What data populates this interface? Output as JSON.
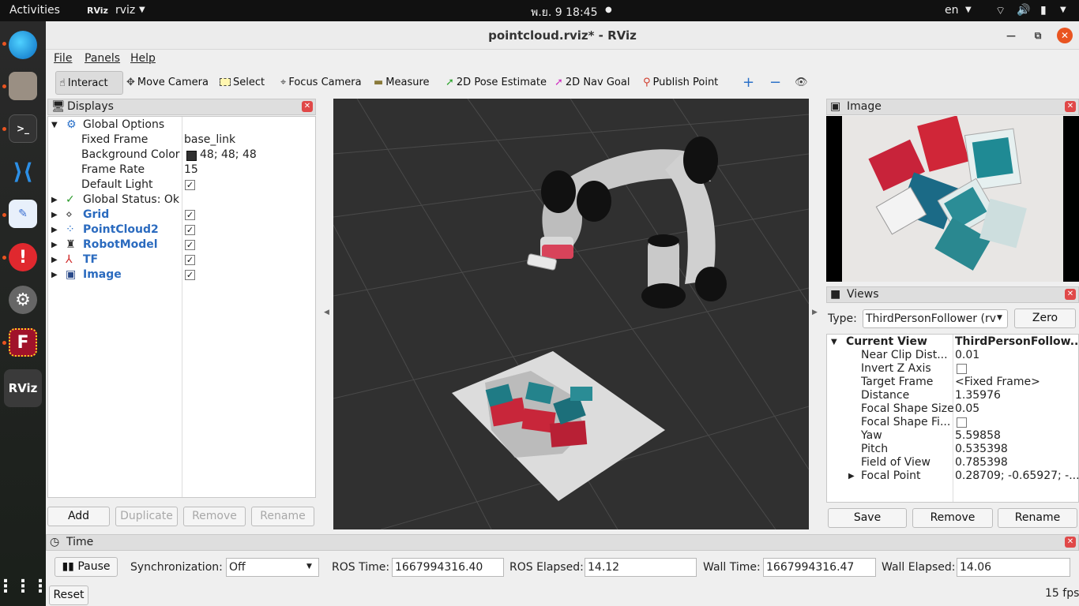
{
  "topbar": {
    "activities": "Activities",
    "app": "rviz",
    "clock": "พ.ย. 9  18:45",
    "lang": "en"
  },
  "window": {
    "title": "pointcloud.rviz* - RViz"
  },
  "menu": {
    "file": "File",
    "panels": "Panels",
    "help": "Help"
  },
  "toolbar": {
    "interact": "Interact",
    "move_camera": "Move Camera",
    "select": "Select",
    "focus_camera": "Focus Camera",
    "measure": "Measure",
    "pose_estimate": "2D Pose Estimate",
    "nav_goal": "2D Nav Goal",
    "publish_point": "Publish Point"
  },
  "displays": {
    "title": "Displays",
    "global_options": "Global Options",
    "fixed_frame_label": "Fixed Frame",
    "fixed_frame_value": "base_link",
    "bg_color_label": "Background Color",
    "bg_color_value": "48; 48; 48",
    "frame_rate_label": "Frame Rate",
    "frame_rate_value": "15",
    "default_light_label": "Default Light",
    "global_status": "Global Status: Ok",
    "grid": "Grid",
    "pointcloud2": "PointCloud2",
    "robotmodel": "RobotModel",
    "tf": "TF",
    "image": "Image",
    "add": "Add",
    "duplicate": "Duplicate",
    "remove": "Remove",
    "rename": "Rename"
  },
  "image_panel": {
    "title": "Image"
  },
  "views": {
    "title": "Views",
    "type_label": "Type:",
    "type_value": "ThirdPersonFollower (rv",
    "zero": "Zero",
    "current_view": "Current View",
    "current_view_value": "ThirdPersonFollow...",
    "props": [
      {
        "k": "Near Clip Dist...",
        "v": "0.01"
      },
      {
        "k": "Invert Z Axis",
        "v": ""
      },
      {
        "k": "Target Frame",
        "v": "<Fixed Frame>"
      },
      {
        "k": "Distance",
        "v": "1.35976"
      },
      {
        "k": "Focal Shape Size",
        "v": "0.05"
      },
      {
        "k": "Focal Shape Fi...",
        "v": ""
      },
      {
        "k": "Yaw",
        "v": "5.59858"
      },
      {
        "k": "Pitch",
        "v": "0.535398"
      },
      {
        "k": "Field of View",
        "v": "0.785398"
      },
      {
        "k": "Focal Point",
        "v": "0.28709; -0.65927; -..."
      }
    ],
    "save": "Save",
    "remove": "Remove",
    "rename": "Rename"
  },
  "time": {
    "title": "Time",
    "pause": "Pause",
    "sync_label": "Synchronization:",
    "sync_value": "Off",
    "ros_time_label": "ROS Time:",
    "ros_time": "1667994316.40",
    "ros_elapsed_label": "ROS Elapsed:",
    "ros_elapsed": "14.12",
    "wall_time_label": "Wall Time:",
    "wall_time": "1667994316.47",
    "wall_elapsed_label": "Wall Elapsed:",
    "wall_elapsed": "14.06",
    "reset": "Reset",
    "fps": "15 fps"
  },
  "colors": {
    "viewport_bg": "#303030",
    "accent_blue": "#2b6bbf",
    "ubuntu_orange": "#e95420"
  }
}
